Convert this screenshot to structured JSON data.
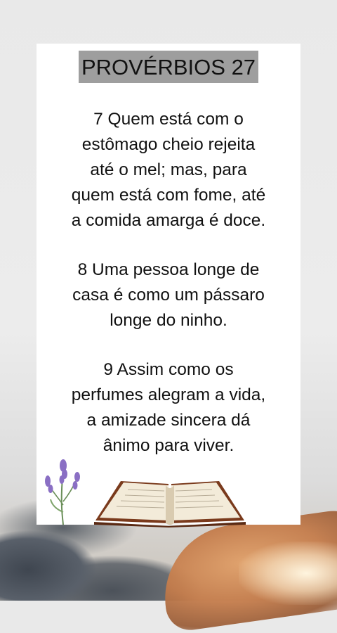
{
  "title": "PROVÉRBIOS 27",
  "verses": [
    "7 Quem está com o\nestômago cheio rejeita\naté o mel; mas, para\nquem está com fome, até\na comida amarga é doce.",
    "8 Uma pessoa longe de\ncasa é como um pássaro\nlonge do ninho.",
    "9 Assim como os\nperfumes alegram a vida,\na amizade sincera dá\nânimo para viver."
  ],
  "icons": [
    "lavender-sprig-icon",
    "open-bible-icon"
  ],
  "colors": {
    "card": "#ffffff",
    "title_highlight": "#9e9e9e",
    "text": "#111111"
  }
}
